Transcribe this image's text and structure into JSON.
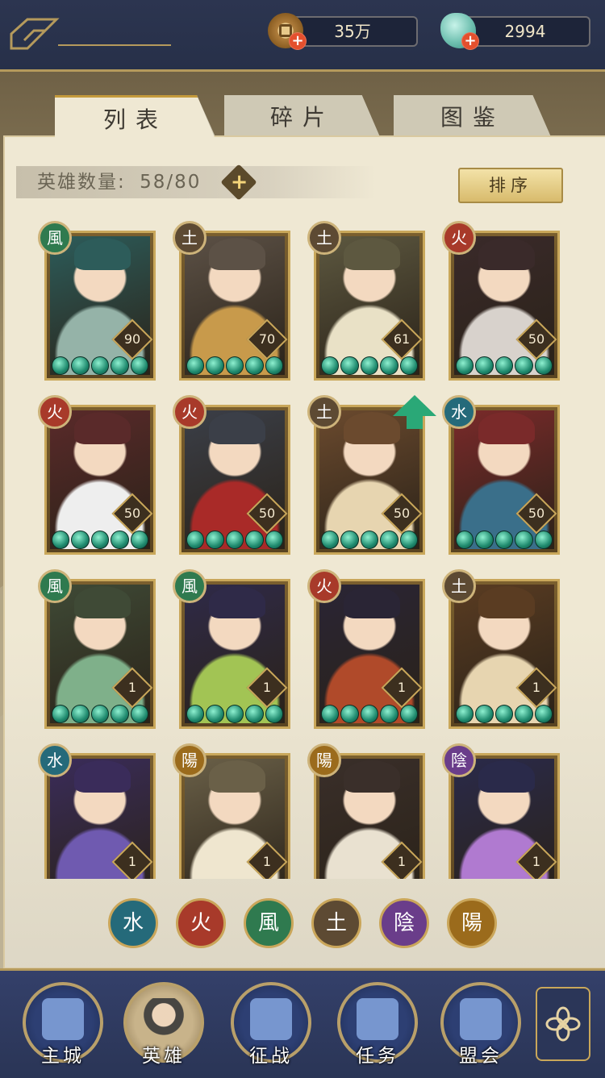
{
  "currency": {
    "coins": "35万",
    "jade": "2994",
    "coin_plus": "+",
    "jade_plus": "+"
  },
  "tabs": [
    {
      "label": "列表",
      "active": true
    },
    {
      "label": "碎片",
      "active": false
    },
    {
      "label": "图鉴",
      "active": false
    }
  ],
  "hero_count": {
    "label": "英雄数量:",
    "value": "58/80",
    "plus": "+"
  },
  "sort_label": "排序",
  "elements": {
    "wind": {
      "glyph": "風",
      "color": "#2f7a4f"
    },
    "earth": {
      "glyph": "土",
      "color": "#5d4a33"
    },
    "fire": {
      "glyph": "火",
      "color": "#a83a2a"
    },
    "water": {
      "glyph": "水",
      "color": "#256a7a"
    },
    "yin": {
      "glyph": "陰",
      "color": "#6a3d8a"
    },
    "yang": {
      "glyph": "陽",
      "color": "#9b6b1c"
    }
  },
  "heroes": [
    {
      "element": "wind",
      "level": "90",
      "stars": 5,
      "tone": [
        "#2d5c5a",
        "#95b3a8"
      ]
    },
    {
      "element": "earth",
      "level": "70",
      "stars": 5,
      "tone": [
        "#5c5146",
        "#c89a4b"
      ]
    },
    {
      "element": "earth",
      "level": "61",
      "stars": 5,
      "tone": [
        "#5d5840",
        "#e9e1c6"
      ]
    },
    {
      "element": "fire",
      "level": "50",
      "stars": 5,
      "tone": [
        "#3a2a2a",
        "#d8d2cc"
      ]
    },
    {
      "element": "fire",
      "level": "50",
      "stars": 5,
      "tone": [
        "#5a2a2a",
        "#eeeeee"
      ]
    },
    {
      "element": "fire",
      "level": "50",
      "stars": 5,
      "tone": [
        "#3b3f48",
        "#a92a28"
      ]
    },
    {
      "element": "earth",
      "level": "50",
      "stars": 5,
      "tone": [
        "#6b4a2e",
        "#e7d5b0"
      ],
      "upgrade": true
    },
    {
      "element": "water",
      "level": "50",
      "stars": 5,
      "tone": [
        "#7a2a2a",
        "#3a6f8a"
      ]
    },
    {
      "element": "wind",
      "level": "1",
      "stars": 5,
      "tone": [
        "#3f4a36",
        "#7fb08a"
      ]
    },
    {
      "element": "wind",
      "level": "1",
      "stars": 5,
      "tone": [
        "#2f2a48",
        "#a2c454"
      ]
    },
    {
      "element": "fire",
      "level": "1",
      "stars": 5,
      "tone": [
        "#2a2535",
        "#b04a2a"
      ]
    },
    {
      "element": "earth",
      "level": "1",
      "stars": 5,
      "tone": [
        "#5a3c22",
        "#e7d5b0"
      ]
    },
    {
      "element": "water",
      "level": "1",
      "stars": 0,
      "tone": [
        "#3a2c5a",
        "#6f5ab0"
      ]
    },
    {
      "element": "yang",
      "level": "1",
      "stars": 0,
      "tone": [
        "#6a6048",
        "#efe6cf"
      ]
    },
    {
      "element": "yang",
      "level": "1",
      "stars": 0,
      "tone": [
        "#3a2f2a",
        "#e9e1d0"
      ]
    },
    {
      "element": "yin",
      "level": "1",
      "stars": 0,
      "tone": [
        "#2a2a4a",
        "#b07ad0"
      ]
    }
  ],
  "filters": [
    "water",
    "fire",
    "wind",
    "earth",
    "yin",
    "yang"
  ],
  "nav": [
    {
      "label": "主城",
      "icon": "castle-icon"
    },
    {
      "label": "英雄",
      "icon": "hero-icon"
    },
    {
      "label": "征战",
      "icon": "battle-icon"
    },
    {
      "label": "任务",
      "icon": "scroll-icon"
    },
    {
      "label": "盟会",
      "icon": "guild-icon"
    }
  ]
}
